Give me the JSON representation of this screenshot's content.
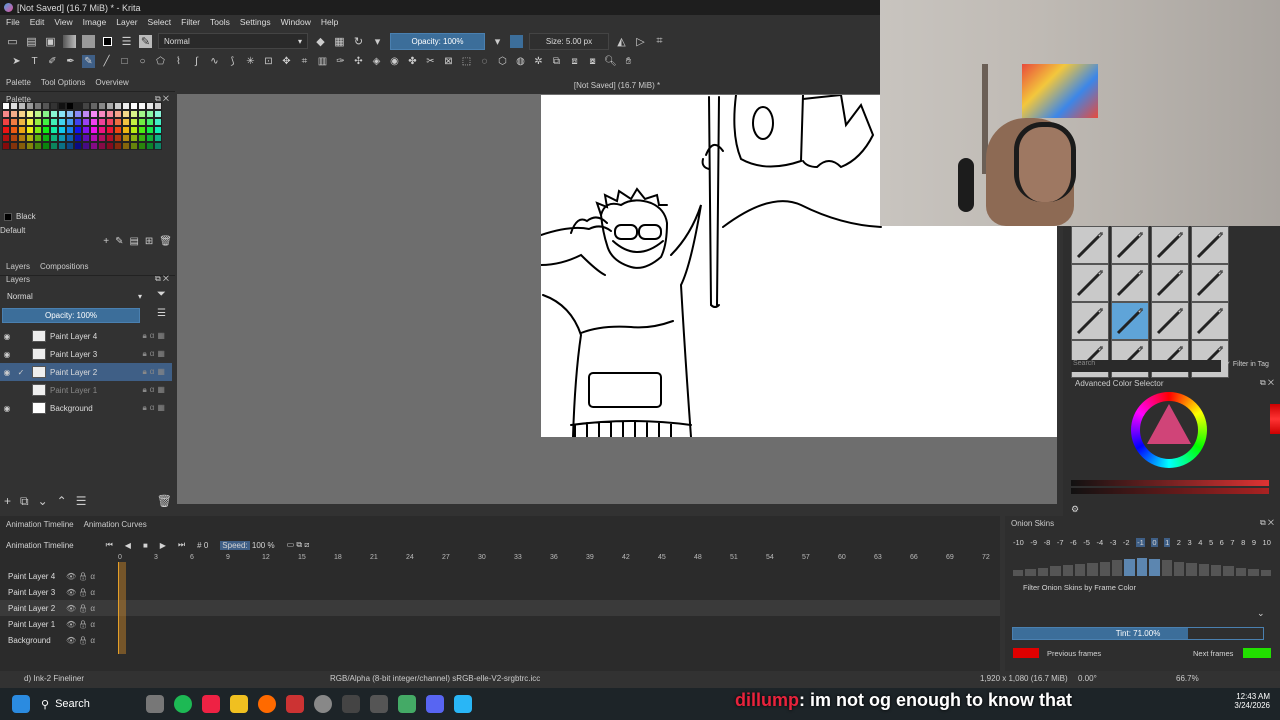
{
  "window": {
    "title": "[Not Saved]  (16.7 MiB) * - Krita"
  },
  "menu": [
    "File",
    "Edit",
    "View",
    "Image",
    "Layer",
    "Select",
    "Filter",
    "Tools",
    "Settings",
    "Window",
    "Help"
  ],
  "toolbar": {
    "blend_mode": "Normal",
    "opacity": "Opacity: 100%",
    "size": "Size: 5.00 px"
  },
  "left_dock": {
    "tabs": [
      "Palette",
      "Tool Options",
      "Overview"
    ],
    "palette_title": "Palette",
    "current_color_name": "Black",
    "palette_set": "Default",
    "layers_tabs": [
      "Layers",
      "Compositions"
    ],
    "layers_title": "Layers",
    "layer_blend": "Normal",
    "layer_opacity": "Opacity:  100%",
    "layers": [
      {
        "name": "Paint Layer 4",
        "selected": false,
        "visible": true
      },
      {
        "name": "Paint Layer 3",
        "selected": false,
        "visible": true
      },
      {
        "name": "Paint Layer 2",
        "selected": true,
        "visible": true
      },
      {
        "name": "Paint Layer 1",
        "selected": false,
        "visible": false
      },
      {
        "name": "Background",
        "selected": false,
        "visible": true
      }
    ]
  },
  "canvas": {
    "header": "[Not Saved]  (16.7 MiB) *"
  },
  "right_dock": {
    "search_placeholder": "Search",
    "filter_in_tag": "Filter in Tag",
    "color_selector_title": "Advanced Color Selector"
  },
  "timeline": {
    "tabs": [
      "Animation Timeline",
      "Animation Curves"
    ],
    "title": "Animation Timeline",
    "frame": "0",
    "speed_label": "Speed:",
    "speed_value": "100 %",
    "ruler": [
      "0",
      "3",
      "6",
      "9",
      "12",
      "15",
      "18",
      "21",
      "24",
      "27",
      "30",
      "33",
      "36",
      "39",
      "42",
      "45",
      "48",
      "51",
      "54",
      "57",
      "60",
      "63",
      "66",
      "69",
      "72"
    ],
    "layers": [
      "Paint Layer 4",
      "Paint Layer 3",
      "Paint Layer 2",
      "Paint Layer 1",
      "Background"
    ]
  },
  "onion": {
    "title": "Onion Skins",
    "numbers": [
      "-10",
      "-9",
      "-8",
      "-7",
      "-6",
      "-5",
      "-4",
      "-3",
      "-2",
      "-1",
      "0",
      "1",
      "2",
      "3",
      "4",
      "5",
      "6",
      "7",
      "8",
      "9",
      "10"
    ],
    "filter": "Filter Onion Skins by Frame Color",
    "tint": "Tint: 71.00%",
    "previous": "Previous frames",
    "next": "Next frames",
    "prev_color": "#e00000",
    "next_color": "#22e000"
  },
  "status": {
    "brush": "d) Ink-2 Fineliner",
    "color_space": "RGB/Alpha (8-bit integer/channel)  sRGB-elle-V2-srgbtrc.icc",
    "dims": "1,920 x 1,080 (16.7 MiB)",
    "rotation": "0.00°",
    "zoom": "66.7%"
  },
  "taskbar": {
    "search": "Search",
    "time": "12:43 AM",
    "date": "3/24/2026"
  },
  "chat": {
    "user": "dillump",
    "message": ": im not og enough to know that"
  }
}
